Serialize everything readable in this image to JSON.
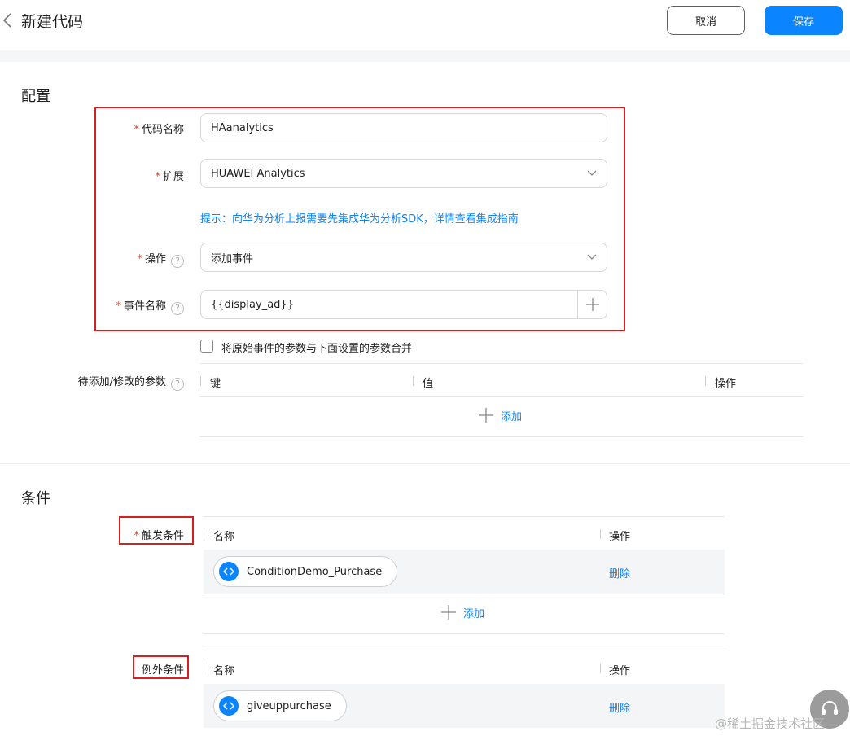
{
  "header": {
    "title": "新建代码",
    "cancel_label": "取消",
    "save_label": "保存"
  },
  "config": {
    "section_title": "配置",
    "code_name_label": "代码名称",
    "code_name_value": "HAanalytics",
    "extension_label": "扩展",
    "extension_value": "HUAWEI Analytics",
    "hint": "提示：向华为分析上报需要先集成华为分析SDK，详情查看集成指南",
    "operation_label": "操作",
    "operation_value": "添加事件",
    "event_name_label": "事件名称",
    "event_name_value": "{{display_ad}}",
    "merge_checkbox_label": "将原始事件的参数与下面设置的参数合并",
    "merge_checked": false,
    "params_label": "待添加/修改的参数",
    "params_columns": [
      "键",
      "值",
      "操作"
    ],
    "params_add_label": "添加"
  },
  "conditions": {
    "section_title": "条件",
    "trigger_label": "触发条件",
    "trigger_columns": [
      "名称",
      "操作"
    ],
    "trigger_rows": [
      {
        "name": "ConditionDemo_Purchase",
        "action": "删除"
      }
    ],
    "trigger_add_label": "添加",
    "exception_label": "例外条件",
    "exception_columns": [
      "名称",
      "操作"
    ],
    "exception_rows": [
      {
        "name": "giveuppurchase",
        "action": "删除"
      }
    ]
  },
  "required_mark": "*",
  "help_mark": "?",
  "watermark": "@稀土掘金技术社区",
  "colors": {
    "accent": "#0a84ff",
    "required": "#e84026",
    "highlight_box": "#d42020"
  }
}
